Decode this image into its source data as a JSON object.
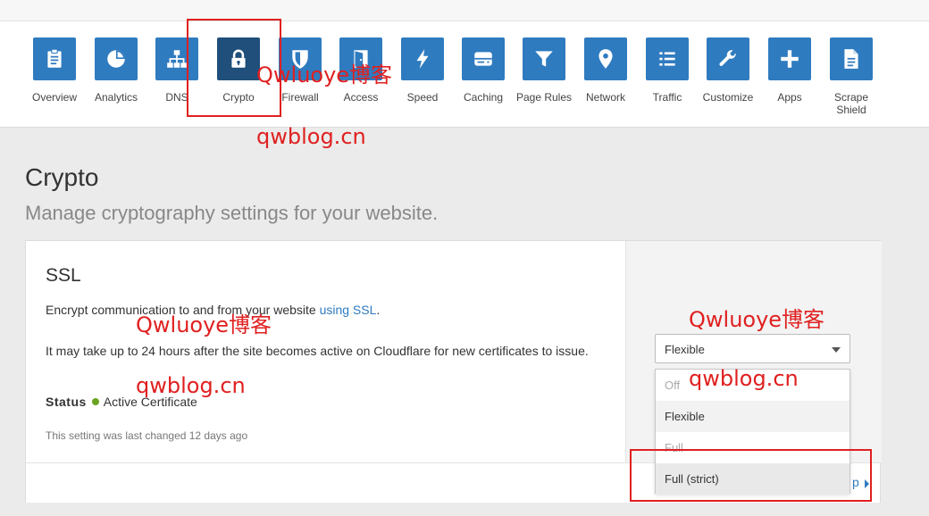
{
  "nav": {
    "items": [
      {
        "label": "Overview",
        "icon": "clipboard-icon"
      },
      {
        "label": "Analytics",
        "icon": "pie-chart-icon"
      },
      {
        "label": "DNS",
        "icon": "network-tree-icon"
      },
      {
        "label": "Crypto",
        "icon": "lock-icon"
      },
      {
        "label": "Firewall",
        "icon": "shield-icon"
      },
      {
        "label": "Access",
        "icon": "door-icon"
      },
      {
        "label": "Speed",
        "icon": "lightning-icon"
      },
      {
        "label": "Caching",
        "icon": "hard-drive-icon"
      },
      {
        "label": "Page Rules",
        "icon": "filter-icon"
      },
      {
        "label": "Network",
        "icon": "location-pin-icon"
      },
      {
        "label": "Traffic",
        "icon": "list-icon"
      },
      {
        "label": "Customize",
        "icon": "wrench-icon"
      },
      {
        "label": "Apps",
        "icon": "plus-icon"
      },
      {
        "label": "Scrape Shield",
        "icon": "document-icon"
      }
    ],
    "active": "Crypto"
  },
  "page": {
    "title": "Crypto",
    "subtitle": "Manage cryptography settings for your website."
  },
  "ssl": {
    "title": "SSL",
    "desc_before": "Encrypt communication to and from your website ",
    "desc_link": "using SSL",
    "desc_after": ".",
    "note": "It may take up to 24 hours after the site becomes active on Cloudflare for new certificates to issue.",
    "status_label": "Status",
    "status_value": "Active Certificate",
    "last_changed": "This setting was last changed 12 days ago",
    "select_value": "Flexible",
    "options": [
      {
        "label": "Off",
        "state": "disabled"
      },
      {
        "label": "Flexible",
        "state": "hover"
      },
      {
        "label": "Full",
        "state": "disabled"
      },
      {
        "label": "Full (strict)",
        "state": "selected"
      }
    ],
    "help_link": "p"
  },
  "watermarks": {
    "name": "Qwluoye博客",
    "site": "qwblog.cn"
  },
  "colors": {
    "accent": "#2f7bbf",
    "active_tile": "#1f4f7a",
    "status_ok": "#6aa321",
    "annotation": "#e02020"
  }
}
